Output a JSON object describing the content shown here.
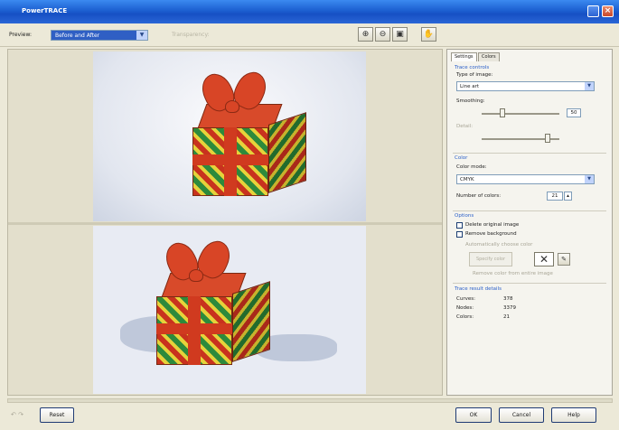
{
  "window": {
    "title": "PowerTRACE"
  },
  "toolbar": {
    "preview_label": "Preview:",
    "preview_value": "Before and After",
    "transparency_label": "Transparency:",
    "zoom_in_icon": "zoom-in-icon",
    "zoom_out_icon": "zoom-out-icon",
    "fit_icon": "zoom-fit-icon",
    "pan_icon": "pan-icon"
  },
  "panel": {
    "tabs": [
      "Settings",
      "Colors"
    ],
    "trace_controls": {
      "title": "Trace controls",
      "type_label": "Type of image:",
      "type_value": "Line art",
      "smoothing_label": "Smoothing:",
      "smoothing_value": "50",
      "detail_label": "Detail:"
    },
    "color": {
      "title": "Color",
      "mode_label": "Color mode:",
      "mode_value": "CMYK",
      "count_label": "Number of colors:",
      "count_value": "21"
    },
    "options": {
      "title": "Options",
      "delete_original": "Delete original image",
      "remove_background": "Remove background",
      "auto_choose": "Automatically choose color",
      "specify_color": "Specify color",
      "remove_whole": "Remove color from entire image"
    },
    "results": {
      "title": "Trace result details",
      "rows": [
        {
          "label": "Curves:",
          "value": "378"
        },
        {
          "label": "Nodes:",
          "value": "3379"
        },
        {
          "label": "Colors:",
          "value": "21"
        }
      ]
    }
  },
  "footer": {
    "reset": "Reset",
    "ok": "OK",
    "cancel": "Cancel",
    "help": "Help"
  },
  "colors": {
    "titlebar": "#1c5fd0",
    "accent": "#2a5fc9"
  }
}
